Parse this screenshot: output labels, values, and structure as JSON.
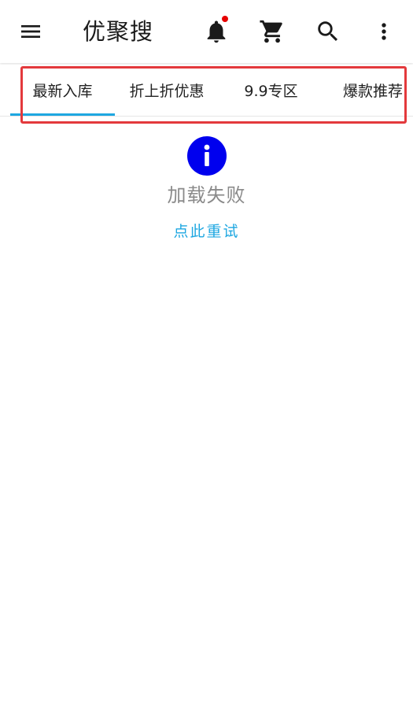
{
  "header": {
    "title": "优聚搜",
    "menu_icon": "menu-icon",
    "bell_icon": "notifications-bell-icon",
    "bell_has_unread_dot": true,
    "cart_icon": "shopping-cart-icon",
    "search_icon": "search-icon",
    "more_icon": "more-vertical-icon"
  },
  "tabs": [
    {
      "label": "最新入库",
      "selected": true
    },
    {
      "label": "折上折优惠",
      "selected": false
    },
    {
      "label": "9.9专区",
      "selected": false
    },
    {
      "label": "爆款推荐",
      "selected": false
    }
  ],
  "load_state": {
    "icon": "info-icon",
    "message": "加载失败",
    "retry_label": "点此重试"
  },
  "colors": {
    "accent": "#1ea7e1",
    "info_icon": "#0000ee",
    "badge": "#e60000",
    "highlight_box": "#e3393c",
    "message_text": "#8a8a8a"
  }
}
